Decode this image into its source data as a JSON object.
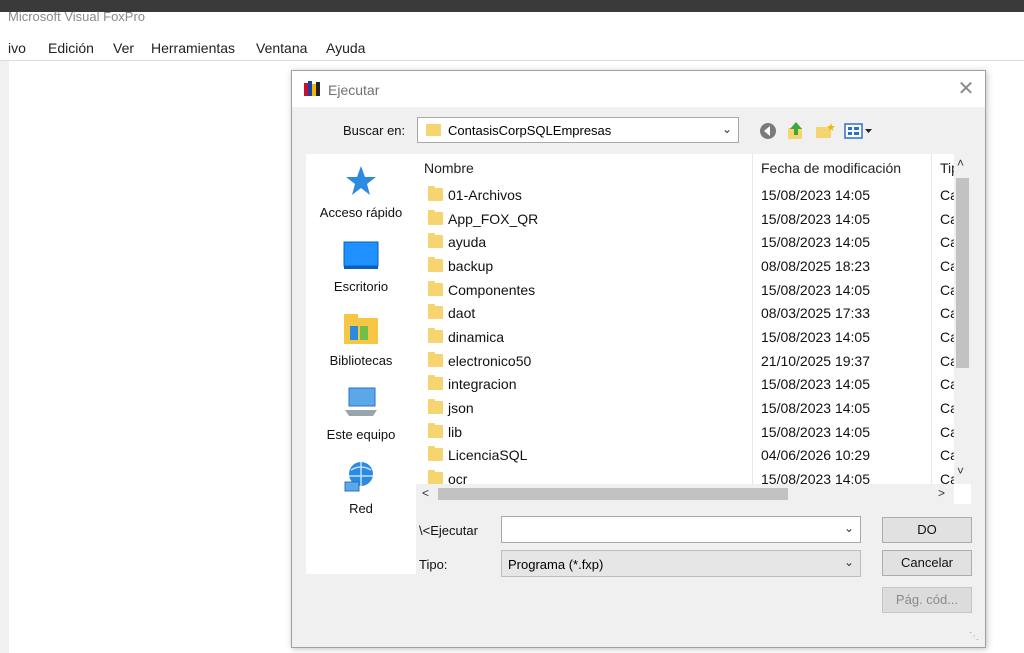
{
  "app": {
    "title": "Microsoft Visual FoxPro",
    "menu": [
      "ivo",
      "Edición",
      "Ver",
      "Herramientas",
      "Ventana",
      "Ayuda"
    ]
  },
  "dialog": {
    "title": "Ejecutar",
    "close_glyph": "✕",
    "look_in_label": "Buscar en:",
    "look_in_value": "ContasisCorpSQLEmpresas",
    "places": [
      "Acceso rápido",
      "Escritorio",
      "Bibliotecas",
      "Este equipo",
      "Red"
    ],
    "columns": {
      "name": "Nombre",
      "date": "Fecha de modificación",
      "type": "Tip"
    },
    "files": [
      {
        "name": "01-Archivos",
        "date": "15/08/2023 14:05",
        "type": "Ca"
      },
      {
        "name": "App_FOX_QR",
        "date": "15/08/2023 14:05",
        "type": "Ca"
      },
      {
        "name": "ayuda",
        "date": "15/08/2023 14:05",
        "type": "Ca"
      },
      {
        "name": "backup",
        "date": "08/08/2025 18:23",
        "type": "Ca"
      },
      {
        "name": "Componentes",
        "date": "15/08/2023 14:05",
        "type": "Ca"
      },
      {
        "name": "daot",
        "date": "08/03/2025 17:33",
        "type": "Ca"
      },
      {
        "name": "dinamica",
        "date": "15/08/2023 14:05",
        "type": "Ca"
      },
      {
        "name": "electronico50",
        "date": "21/10/2025 19:37",
        "type": "Ca"
      },
      {
        "name": "integracion",
        "date": "15/08/2023 14:05",
        "type": "Ca"
      },
      {
        "name": "json",
        "date": "15/08/2023 14:05",
        "type": "Ca"
      },
      {
        "name": "lib",
        "date": "15/08/2023 14:05",
        "type": "Ca"
      },
      {
        "name": "LicenciaSQL",
        "date": "04/06/2026 10:29",
        "type": "Ca"
      },
      {
        "name": "ocr",
        "date": "15/08/2023 14:05",
        "type": "Ca"
      }
    ],
    "run_label": "\\<Ejecutar",
    "run_value": "",
    "type_label": "Tipo:",
    "type_value": "Programa (*.fxp)",
    "buttons": {
      "ok": "DO",
      "cancel": "Cancelar",
      "codepage": "Pág. cód..."
    }
  },
  "icons": {
    "title": "foxpro-app-icon",
    "back": "back-arrow-icon",
    "up": "up-folder-icon",
    "newfolder": "new-folder-icon",
    "view": "view-menu-icon"
  },
  "colors": {
    "folder": "#f6d470",
    "dialog_bg": "#f0f0f0",
    "accent": "#1e90ff"
  }
}
